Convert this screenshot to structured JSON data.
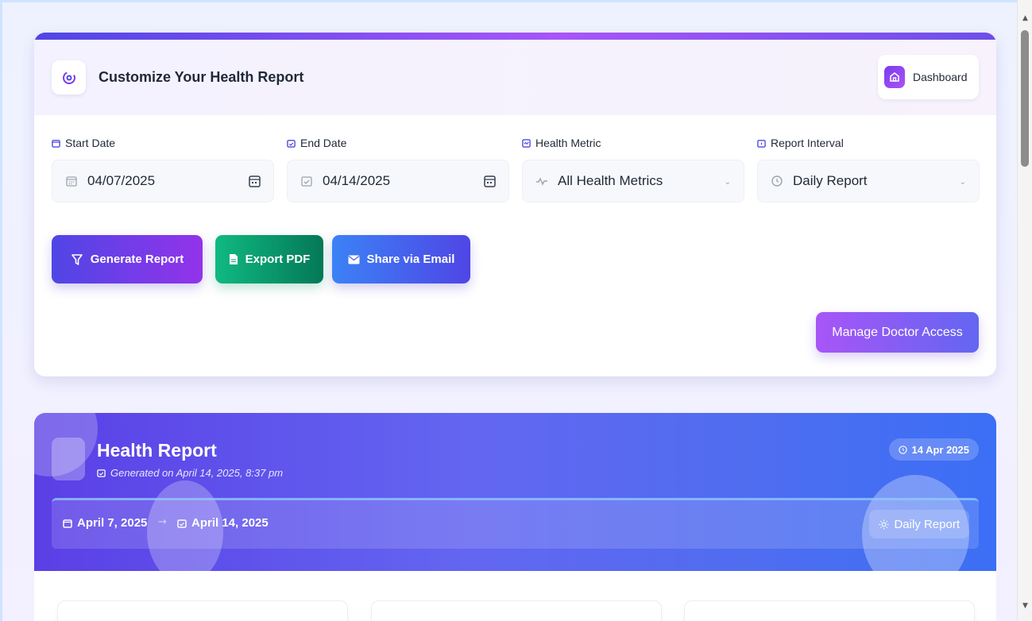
{
  "header": {
    "title": "Customize Your Health Report",
    "dashboard_label": "Dashboard"
  },
  "filters": {
    "start_date": {
      "label": "Start Date",
      "value": "04/07/2025"
    },
    "end_date": {
      "label": "End Date",
      "value": "04/14/2025"
    },
    "health_metric": {
      "label": "Health Metric",
      "value": "All Health Metrics"
    },
    "report_interval": {
      "label": "Report Interval",
      "value": "Daily Report"
    }
  },
  "actions": {
    "generate": "Generate Report",
    "export_pdf": "Export PDF",
    "share_email": "Share via Email",
    "manage_doctor": "Manage Doctor Access"
  },
  "report": {
    "title": "Health Report",
    "generated": "Generated on April 14, 2025, 8:37 pm",
    "date_badge": "14 Apr 2025",
    "range_start": "April 7, 2025",
    "range_end": "April 14, 2025",
    "interval": "Daily Report"
  },
  "colors": {
    "accent": "#6366f1",
    "purple": "#a855f7",
    "green": "#10b981",
    "blue": "#3b82f6"
  }
}
